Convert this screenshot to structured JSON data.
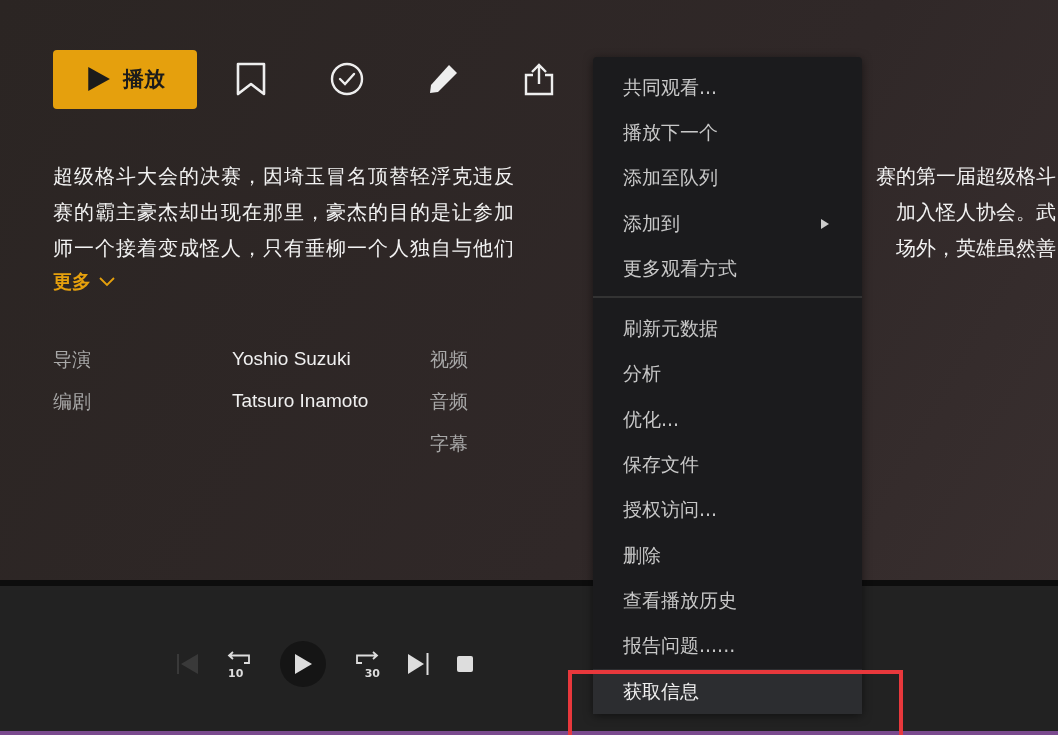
{
  "actions": {
    "play_button": {
      "label": "播放"
    },
    "icons": [
      {
        "kind": "bookmark"
      },
      {
        "kind": "check"
      },
      {
        "kind": "edit"
      },
      {
        "kind": "share"
      }
    ]
  },
  "summary": {
    "lines": [
      {
        "left": "超级格斗大会的决赛，因埼玉冒名顶替轻浮克违反",
        "right": "赛的第一届超级格斗"
      },
      {
        "left": "赛的霸主豪杰却出现在那里，豪杰的目的是让参加",
        "right": "加入怪人协会。武"
      },
      {
        "left": "师一个接着变成怪人，只有垂柳一个人独自与他们",
        "right": "场外，英雄虽然善"
      }
    ],
    "more": "更多"
  },
  "credits": [
    {
      "label": "导演",
      "value": "Yoshio Suzuki"
    },
    {
      "label": "编剧",
      "value": "Tatsuro Inamoto"
    }
  ],
  "media_labels": [
    "视频",
    "音频",
    "字幕"
  ],
  "context_menu": {
    "groups": [
      [
        {
          "label": "共同观看...",
          "submenu": false,
          "selected": false
        },
        {
          "label": "播放下一个",
          "submenu": false,
          "selected": false
        },
        {
          "label": "添加至队列",
          "submenu": false,
          "selected": false
        },
        {
          "label": "添加到",
          "submenu": true,
          "selected": false
        },
        {
          "label": "更多观看方式",
          "submenu": false,
          "selected": false
        }
      ],
      [
        {
          "label": "刷新元数据",
          "submenu": false,
          "selected": false
        },
        {
          "label": "分析",
          "submenu": false,
          "selected": false
        },
        {
          "label": "优化...",
          "submenu": false,
          "selected": false
        },
        {
          "label": "保存文件",
          "submenu": false,
          "selected": false
        },
        {
          "label": "授权访问...",
          "submenu": false,
          "selected": false
        },
        {
          "label": "删除",
          "submenu": false,
          "selected": false
        },
        {
          "label": "查看播放历史",
          "submenu": false,
          "selected": false
        },
        {
          "label": "报告问题......",
          "submenu": false,
          "selected": false
        },
        {
          "label": "获取信息",
          "submenu": false,
          "selected": true
        }
      ]
    ]
  },
  "player_controls": [
    {
      "kind": "previous",
      "disabled": true
    },
    {
      "kind": "replay",
      "label": "10",
      "disabled": false
    },
    {
      "kind": "play",
      "disabled": false
    },
    {
      "kind": "forward",
      "label": "30",
      "disabled": false
    },
    {
      "kind": "next",
      "disabled": false
    },
    {
      "kind": "stop",
      "disabled": false
    }
  ]
}
